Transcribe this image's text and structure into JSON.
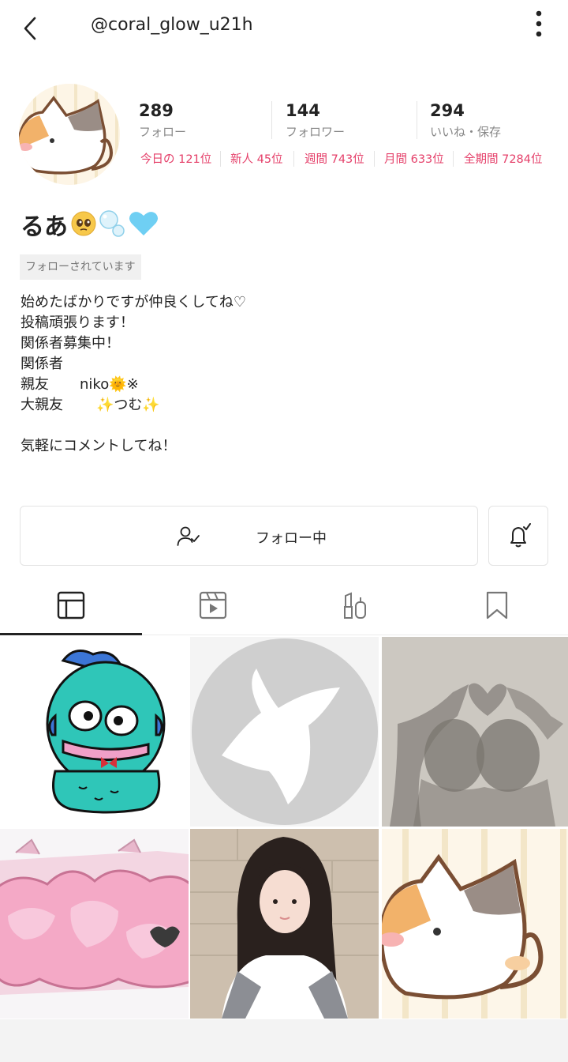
{
  "header": {
    "username": "@coral_glow_u21h"
  },
  "stats": [
    {
      "value": "289",
      "label": "フォロー"
    },
    {
      "value": "144",
      "label": "フォロワー"
    },
    {
      "value": "294",
      "label": "いいね・保存"
    }
  ],
  "ranks": [
    {
      "label": "今日の",
      "value": "121位"
    },
    {
      "label": "新人",
      "value": "45位"
    },
    {
      "label": "週間",
      "value": "743位"
    },
    {
      "label": "月間",
      "value": "633位"
    },
    {
      "label": "全期間",
      "value": "7284位"
    }
  ],
  "profile": {
    "display_name": "るあ",
    "follows_you": "フォローされています",
    "bio": {
      "line1": "始めたばかりですが仲良くしてね♡",
      "line2": "投稿頑張ります！",
      "line3": "関係者募集中！",
      "line4": "関係者",
      "line5_label": "親友",
      "line5_value": "niko🌞※",
      "line6_label": "大親友",
      "line6_value": "✨つむ✨",
      "line7": "気軽にコメントしてね！"
    }
  },
  "actions": {
    "follow_label": "フォロー中"
  },
  "tabs": [
    {
      "name": "posts-grid",
      "icon": "grid-icon",
      "active": true
    },
    {
      "name": "videos",
      "icon": "video-icon",
      "active": false
    },
    {
      "name": "cosmetics",
      "icon": "cosmetics-icon",
      "active": false
    },
    {
      "name": "saved",
      "icon": "bookmark-icon",
      "active": false
    }
  ],
  "colors": {
    "rank_pink": "#e5406a",
    "text": "#222222",
    "muted": "#888888"
  }
}
